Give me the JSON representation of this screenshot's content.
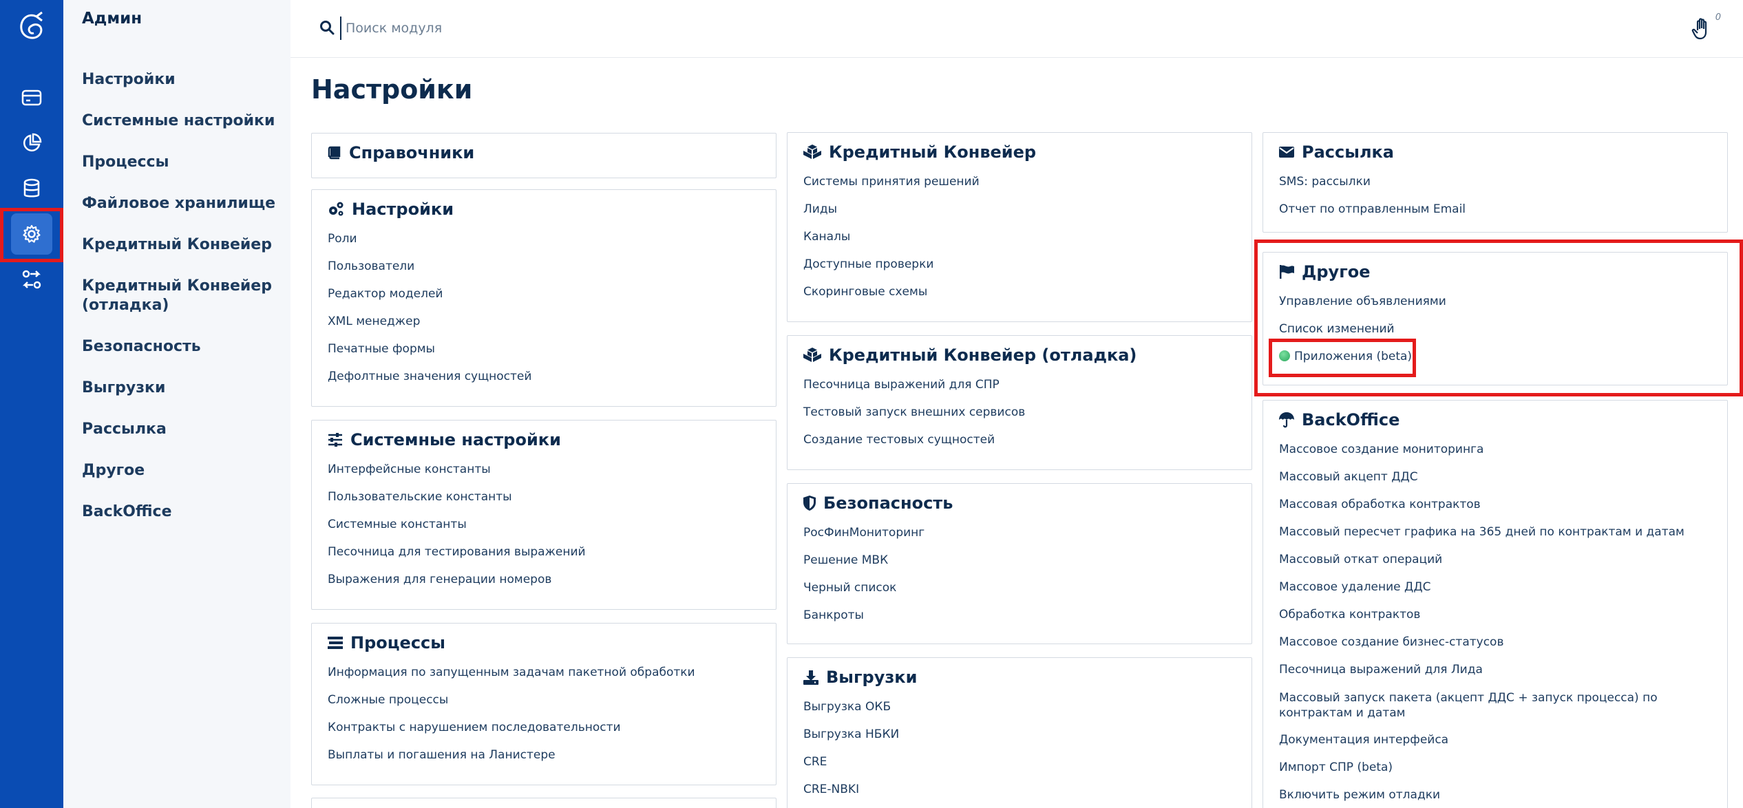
{
  "rail": {
    "items": [
      "logo-icon",
      "card-icon",
      "pie-chart-icon",
      "database-icon",
      "gear-icon",
      "exchange-icon"
    ],
    "active": "gear-icon",
    "colors": {
      "bg": "#0a4cb3",
      "active": "#2f6fd0",
      "highlight": "#e41b1b"
    }
  },
  "nav": {
    "title": "Админ",
    "items": [
      "Настройки",
      "Системные настройки",
      "Процессы",
      "Файловое хранилище",
      "Кредитный Конвейер",
      "Кредитный Конвейер (отладка)",
      "Безопасность",
      "Выгрузки",
      "Рассылка",
      "Другое",
      "BackOffice"
    ]
  },
  "search": {
    "placeholder": "Поиск модуля",
    "value": ""
  },
  "notifications": {
    "count": "0"
  },
  "page": {
    "title": "Настройки"
  },
  "columns": {
    "col1": [
      {
        "title": "Справочники",
        "icon": "book-icon",
        "links": []
      },
      {
        "title": "Настройки",
        "icon": "gears-icon",
        "links": [
          "Роли",
          "Пользователи",
          "Редактор моделей",
          "XML менеджер",
          "Печатные формы",
          "Дефолтные значения сущностей"
        ]
      },
      {
        "title": "Системные настройки",
        "icon": "sliders-icon",
        "links": [
          "Интерфейсные константы",
          "Пользовательские константы",
          "Системные константы",
          "Песочница для тестирования выражений",
          "Выражения для генерации номеров"
        ]
      },
      {
        "title": "Процессы",
        "icon": "stream-icon",
        "links": [
          "Информация по запущенным задачам пакетной обработки",
          "Сложные процессы",
          "Контракты с нарушением последовательности",
          "Выплаты и погашения на Ланистере"
        ]
      }
    ],
    "col2": [
      {
        "title": "Кредитный Конвейер",
        "icon": "cubes-icon",
        "links": [
          "Системы принятия решений",
          "Лиды",
          "Каналы",
          "Доступные проверки",
          "Скоринговые схемы"
        ]
      },
      {
        "title": "Кредитный Конвейер (отладка)",
        "icon": "cubes-icon",
        "links": [
          "Песочница выражений для СПР",
          "Тестовый запуск внешних сервисов",
          "Создание тестовых сущностей"
        ]
      },
      {
        "title": "Безопасность",
        "icon": "shield-icon",
        "links": [
          "РосФинМониторинг",
          "Решение МВК",
          "Черный список",
          "Банкроты"
        ]
      },
      {
        "title": "Выгрузки",
        "icon": "download-icon",
        "links": [
          "Выгрузка ОКБ",
          "Выгрузка НБКИ",
          "CRE",
          "CRE-NBKI"
        ]
      }
    ],
    "col3": [
      {
        "title": "Рассылка",
        "icon": "envelope-icon",
        "links": [
          "SMS: рассылки",
          "Отчет по отправленным Email"
        ]
      },
      {
        "title": "Другое",
        "icon": "flag-icon",
        "links": [
          "Управление объявлениями",
          "Список изменений",
          "Приложения (beta)"
        ]
      },
      {
        "title": "BackOffice",
        "icon": "umbrella-icon",
        "links": [
          "Массовое создание мониторинга",
          "Массовый акцепт ДДС",
          "Массовая обработка контрактов",
          "Массовый пересчет графика на 365 дней по контрактам и датам",
          "Массовый откат операций",
          "Массовое удаление ДДС",
          "Обработка контрактов",
          "Массовое создание бизнес-статусов",
          "Песочница выражений для Лида",
          "Массовый запуск пакета (акцепт ДДС + запуск процесса) по контрактам и датам",
          "Документация интерфейса",
          "Импорт СПР (beta)",
          "Включить режим отладки"
        ]
      }
    ]
  }
}
